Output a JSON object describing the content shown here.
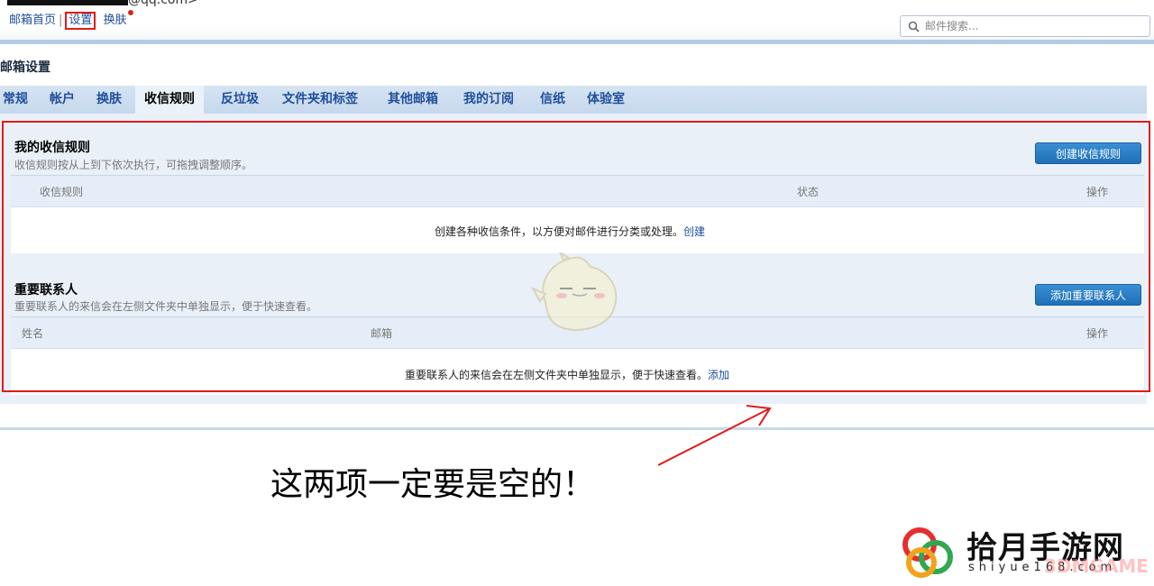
{
  "header": {
    "account_suffix": "@qq.com>",
    "links": {
      "home": "邮箱首页",
      "separator": "|",
      "settings": "设置",
      "skin": "换肤"
    },
    "search_placeholder": "邮件搜索..."
  },
  "page_title": "邮箱设置",
  "tabs": [
    {
      "label": "常规",
      "active": false
    },
    {
      "label": "帐户",
      "active": false
    },
    {
      "label": "换肤",
      "active": false
    },
    {
      "label": "收信规则",
      "active": true
    },
    {
      "label": "反垃圾",
      "active": false
    },
    {
      "label": "文件夹和标签",
      "active": false
    },
    {
      "label": "其他邮箱",
      "active": false
    },
    {
      "label": "我的订阅",
      "active": false
    },
    {
      "label": "信纸",
      "active": false
    },
    {
      "label": "体验室",
      "active": false
    }
  ],
  "rules_section": {
    "title": "我的收信规则",
    "description": "收信规则按从上到下依次执行，可拖拽调整顺序。",
    "button": "创建收信规则",
    "columns": [
      "收信规则",
      "状态",
      "操作"
    ],
    "empty_text": "创建各种收信条件，以方便对邮件进行分类或处理。",
    "empty_link": "创建"
  },
  "contacts_section": {
    "title": "重要联系人",
    "description": "重要联系人的来信会在左侧文件夹中单独显示，便于快速查看。",
    "button": "添加重要联系人",
    "columns": [
      "姓名",
      "邮箱",
      "操作"
    ],
    "empty_text": "重要联系人的来信会在左侧文件夹中单独显示，便于快速查看。",
    "empty_link": "添加"
  },
  "annotation": "这两项一定要是空的！",
  "watermark": {
    "name": "拾月手游网",
    "url": "shiyue168.com",
    "overlay": "3DMGAME"
  },
  "colors": {
    "accent": "#1e6fb7",
    "highlight": "#e01b1b",
    "tab_bar": "#c6d8ec",
    "panel": "#e9f0f8"
  }
}
